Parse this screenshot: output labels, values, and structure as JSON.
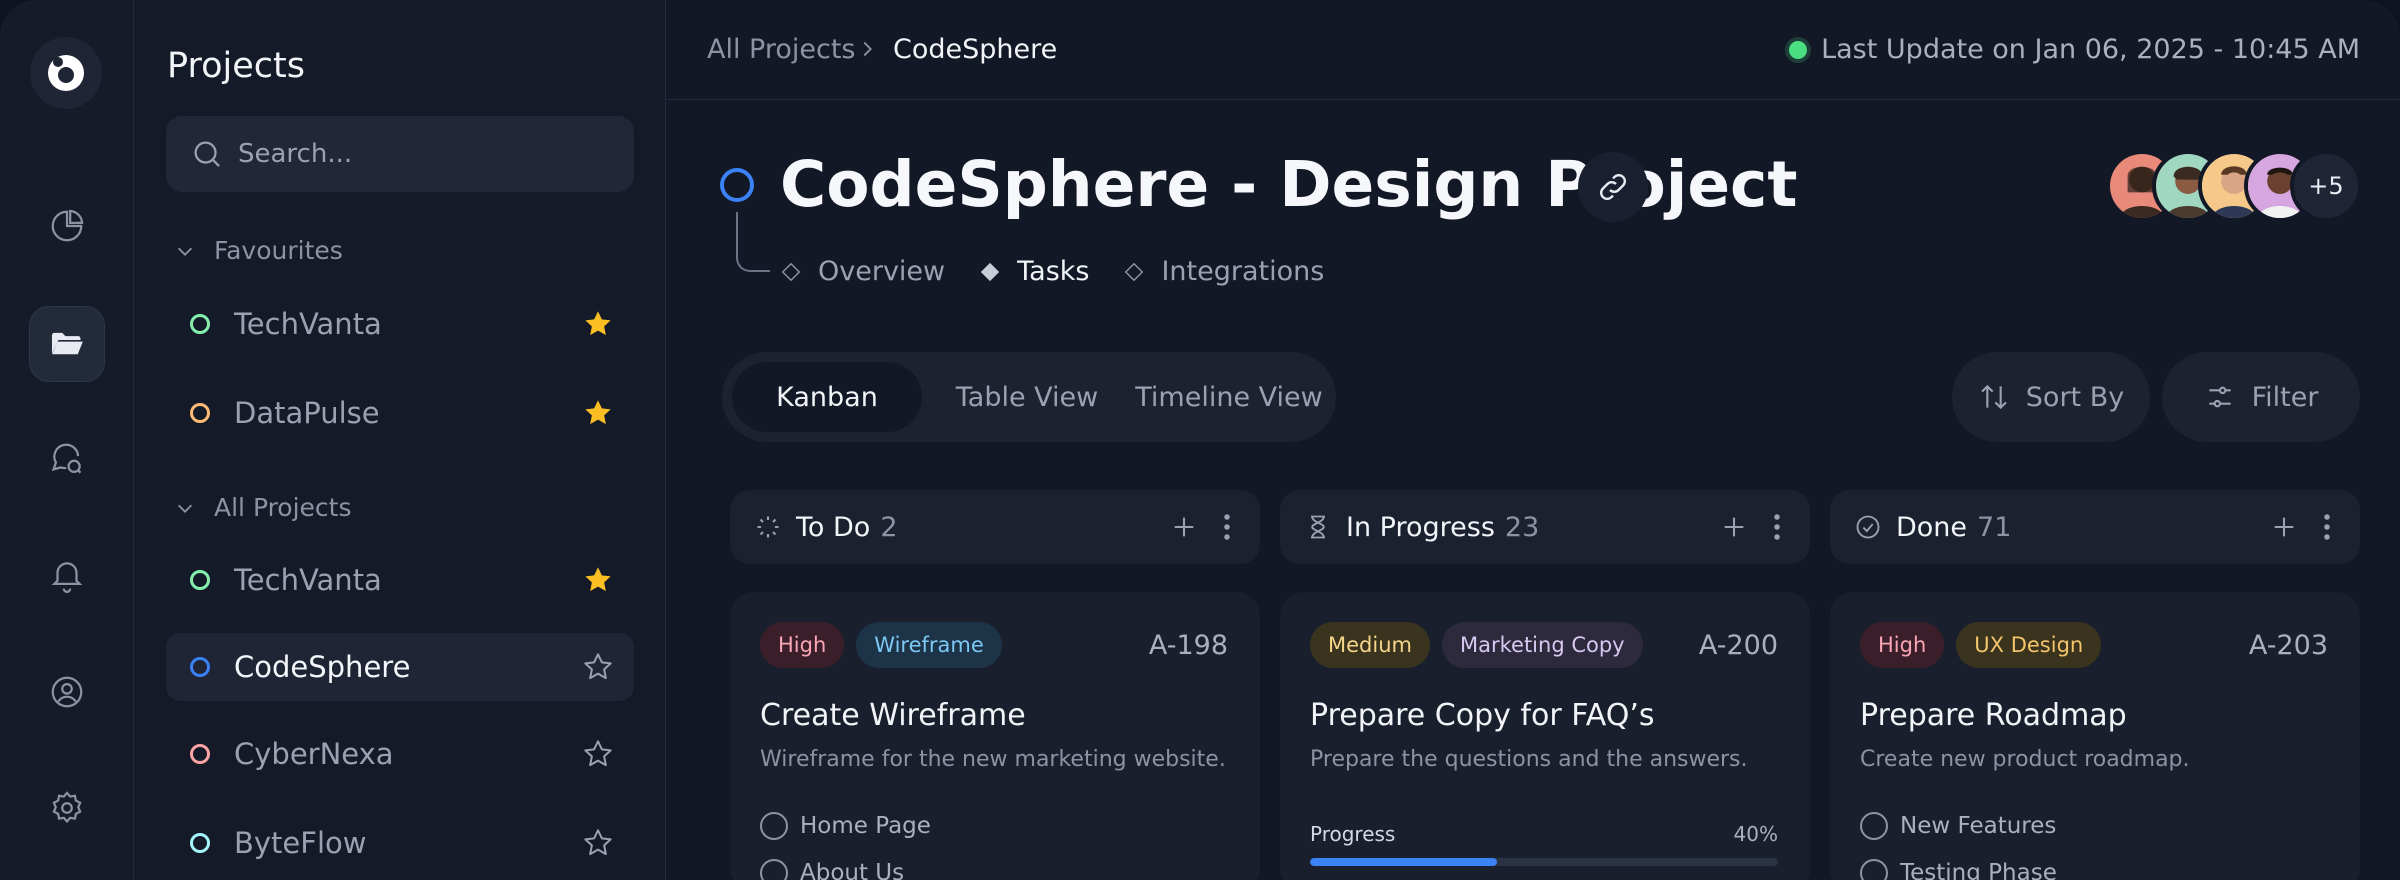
{
  "sidebar": {
    "title": "Projects",
    "search_placeholder": "Search...",
    "favourites_label": "Favourites",
    "all_projects_label": "All Projects",
    "favourites": [
      {
        "name": "TechVanta",
        "color": "#86efac",
        "starred": true
      },
      {
        "name": "DataPulse",
        "color": "#fdba74",
        "starred": true
      }
    ],
    "projects": [
      {
        "name": "TechVanta",
        "color": "#86efac",
        "starred": true
      },
      {
        "name": "CodeSphere",
        "color": "#3b82f6",
        "starred": false,
        "active": true
      },
      {
        "name": "CyberNexa",
        "color": "#fca5a5",
        "starred": false
      },
      {
        "name": "ByteFlow",
        "color": "#a5f3fc",
        "starred": false
      }
    ]
  },
  "rail": {
    "icons": [
      "logo-icon",
      "analytics-icon",
      "folder-icon",
      "chat-icon",
      "bell-icon",
      "user-icon",
      "settings-icon"
    ]
  },
  "breadcrumb": {
    "parent": "All Projects",
    "current": "CodeSphere"
  },
  "last_update": "Last Update on Jan 06, 2025 - 10:45 AM",
  "project": {
    "title": "CodeSphere - Design Project",
    "status_color": "#3b82f6",
    "tabs": [
      {
        "label": "Overview",
        "active": false
      },
      {
        "label": "Tasks",
        "active": true
      },
      {
        "label": "Integrations",
        "active": false
      }
    ]
  },
  "members": {
    "more": "+5"
  },
  "views": {
    "kanban": "Kanban",
    "table": "Table View",
    "timeline": "Timeline View"
  },
  "actions": {
    "sort": "Sort By",
    "filter": "Filter"
  },
  "columns": [
    {
      "name": "To Do",
      "count": "2",
      "card": {
        "tags": [
          {
            "label": "High",
            "bg": "#3a1f2a",
            "fg": "#f8a5b4"
          },
          {
            "label": "Wireframe",
            "bg": "#1d3347",
            "fg": "#7cc8f5"
          }
        ],
        "id": "A-198",
        "title": "Create Wireframe",
        "desc": "Wireframe for the new marketing website.",
        "checks": [
          "Home Page",
          "About Us"
        ]
      }
    },
    {
      "name": "In Progress",
      "count": "23",
      "card": {
        "tags": [
          {
            "label": "Medium",
            "bg": "#3a331e",
            "fg": "#f4d58a"
          },
          {
            "label": "Marketing Copy",
            "bg": "#2e2a3e",
            "fg": "#d6c8f0"
          }
        ],
        "id": "A-200",
        "title": "Prepare Copy for FAQ’s",
        "desc": "Prepare the questions and the answers.",
        "progress_label": "Progress",
        "progress_text": "40%",
        "progress": 0.4
      }
    },
    {
      "name": "Done",
      "count": "71",
      "card": {
        "tags": [
          {
            "label": "High",
            "bg": "#3a1f2a",
            "fg": "#f8a5b4"
          },
          {
            "label": "UX Design",
            "bg": "#3a331e",
            "fg": "#f4c56a"
          }
        ],
        "id": "A-203",
        "title": "Prepare Roadmap",
        "desc": "Create new product roadmap.",
        "checks": [
          "New Features",
          "Testing Phase"
        ]
      }
    }
  ]
}
